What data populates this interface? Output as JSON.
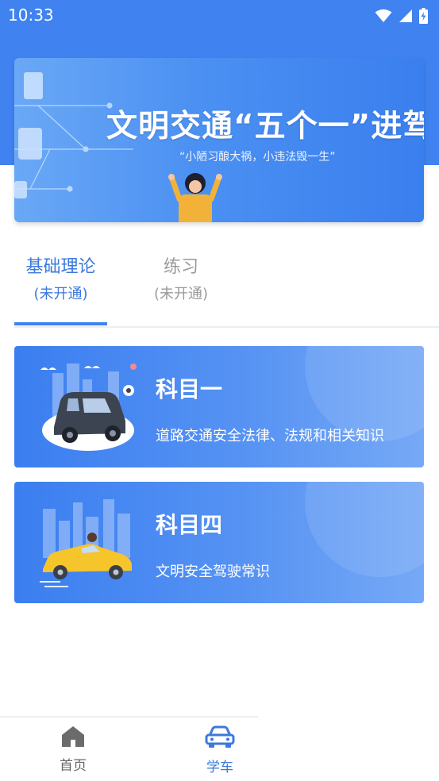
{
  "status_bar": {
    "time": "10:33"
  },
  "banner": {
    "title": "文明交通“五个一”进驾校",
    "subtitle": "“小陋习酿大祸，小违法毁一生”"
  },
  "tabs": [
    {
      "label": "基础理论",
      "status": "(未开通)",
      "active": true
    },
    {
      "label": "练习",
      "status": "(未开通)",
      "active": false
    }
  ],
  "cards": [
    {
      "title": "科目一",
      "description": "道路交通安全法律、法规和相关知识"
    },
    {
      "title": "科目四",
      "description": "文明安全驾驶常识"
    }
  ],
  "bottom_nav": [
    {
      "label": "首页",
      "icon": "home-icon",
      "active": false
    },
    {
      "label": "学车",
      "icon": "car-icon",
      "active": true
    }
  ],
  "colors": {
    "primary": "#3f82f0",
    "active_text": "#3c79db",
    "inactive_text": "#9a9a9a"
  }
}
